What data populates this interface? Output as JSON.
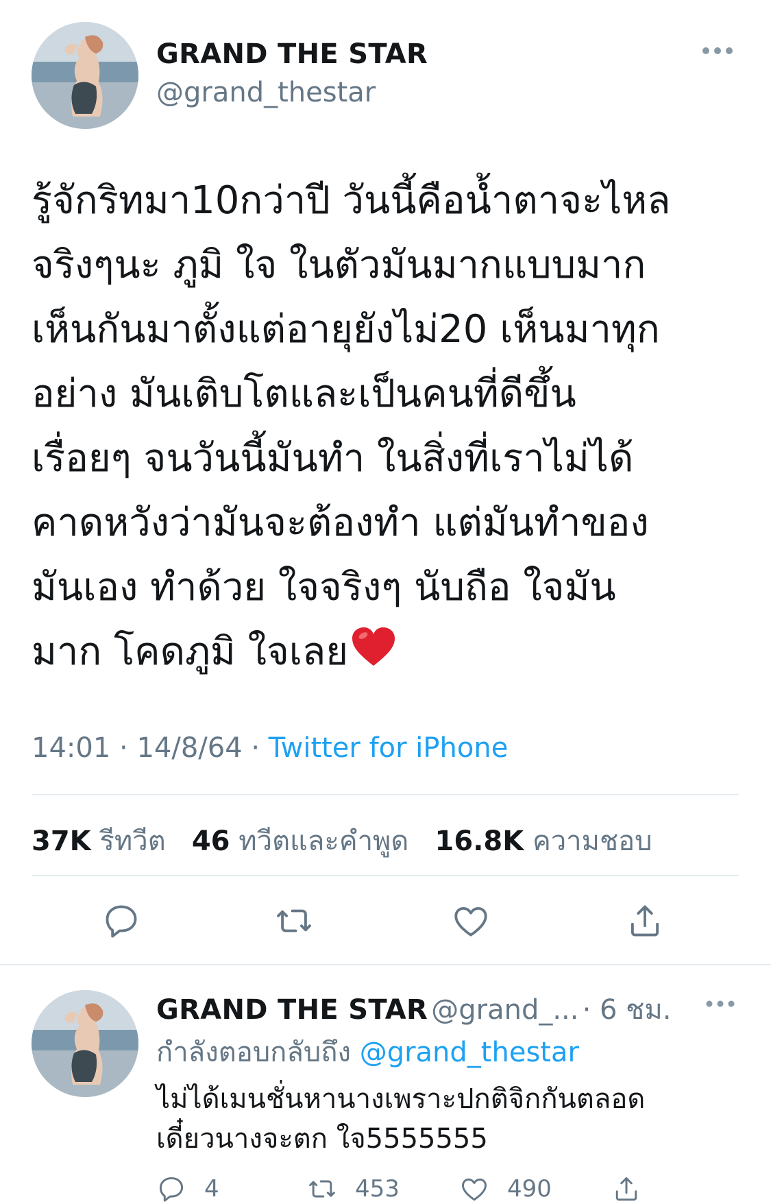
{
  "tweet": {
    "display_name": "GRAND THE STAR",
    "handle": "@grand_thestar",
    "more_icon": "ellipsis-icon",
    "text_lines": [
      "รู้จักริทมา10กว่าปี วันนี้คือน้ำตาจะไหล",
      "จริงๆนะ ภูมิ ใจ ในตัวมันมากแบบมาก",
      "เห็นกันมาตั้งแต่อายุยังไม่20 เห็นมาทุก",
      "อย่าง มันเติบโตและเป็นคนที่ดีขึ้น",
      "เรื่อยๆ จนวันนี้มันทำ ในสิ่งที่เราไม่ได้",
      "คาดหวังว่ามันจะต้องทำ แต่มันทำของ",
      "มันเอง ทำด้วย ใจจริงๆ นับถือ ใจมัน",
      "มาก โคดภูมิ ใจเลย"
    ],
    "time": "14:01",
    "date": "14/8/64",
    "separator": "·",
    "source": "Twitter for iPhone",
    "stats": {
      "retweets_count": "37K",
      "retweets_label": "รีทวีต",
      "quotes_count": "46",
      "quotes_label": "ทวีตและคำพูด",
      "likes_count": "16.8K",
      "likes_label": "ความชอบ"
    },
    "actions": [
      "reply-icon",
      "retweet-icon",
      "like-icon",
      "share-icon"
    ],
    "accent_color": "#1da1f2",
    "heart_emoji_color": "#e0202f"
  },
  "reply": {
    "display_name": "GRAND THE STAR",
    "handle": "@grand_...",
    "time_ago": "· 6 ชม.",
    "replying_label": "กำลังตอบกลับถึง",
    "replying_to": "@grand_thestar",
    "text_lines": [
      "ไม่ได้เมนชั่นหานางเพราะปกติจิกกันตลอด",
      "เดี๋ยวนางจะตก ใจ5555555"
    ],
    "reply_count": "4",
    "retweet_count": "453",
    "like_count": "490"
  }
}
